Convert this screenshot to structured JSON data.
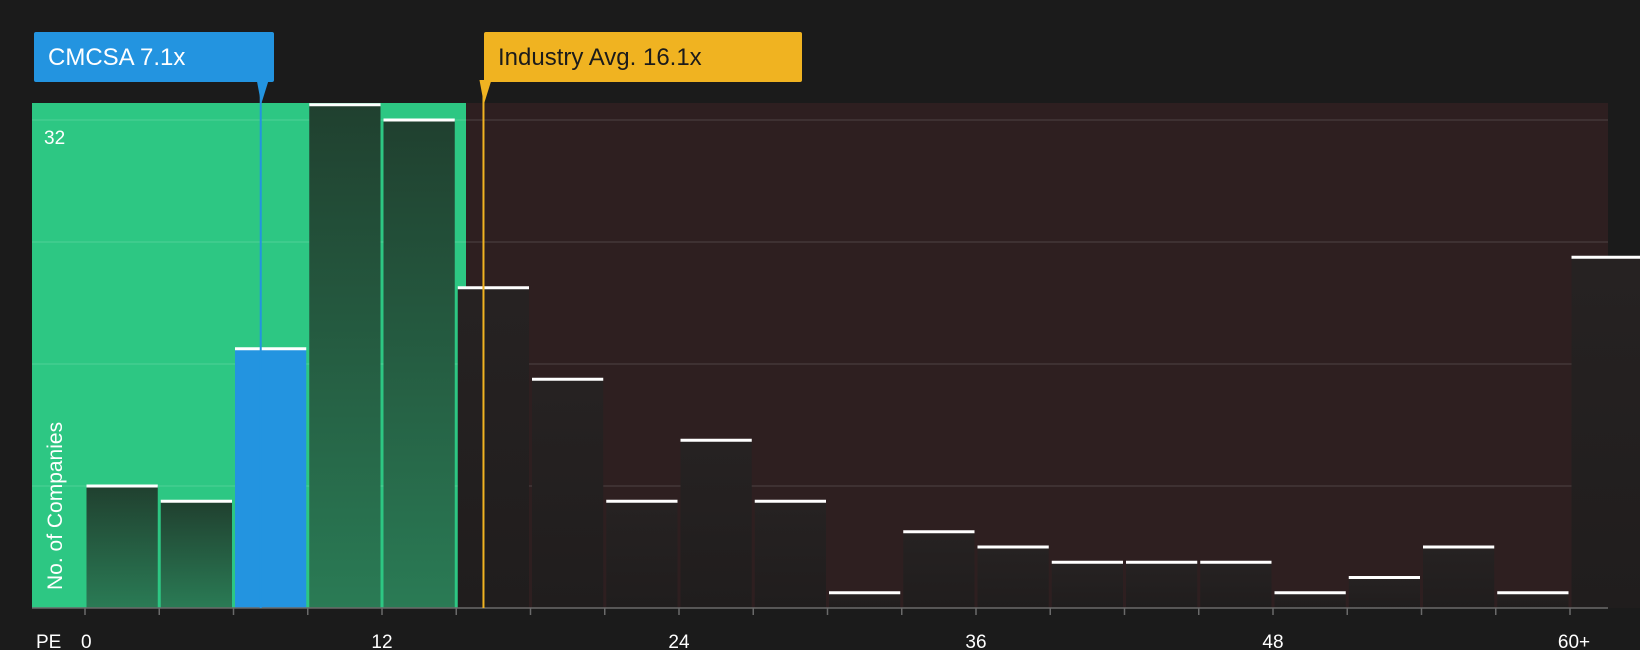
{
  "chart_data": {
    "type": "bar",
    "x_axis_title": "PE",
    "y_axis_title": "No. of Companies",
    "y_tick_label": "32",
    "x_tick_labels": [
      "0",
      "12",
      "24",
      "36",
      "48",
      "60+"
    ],
    "x_tick_values": [
      0,
      12,
      24,
      36,
      48,
      60
    ],
    "xlim": [
      0,
      61.5
    ],
    "ylim": [
      0,
      32
    ],
    "bin_width": 3,
    "bins": [
      {
        "x": 0,
        "count": 8
      },
      {
        "x": 3,
        "count": 7
      },
      {
        "x": 6,
        "count": 17
      },
      {
        "x": 9,
        "count": 33
      },
      {
        "x": 12,
        "count": 32
      },
      {
        "x": 15,
        "count": 21
      },
      {
        "x": 18,
        "count": 15
      },
      {
        "x": 21,
        "count": 7
      },
      {
        "x": 24,
        "count": 11
      },
      {
        "x": 27,
        "count": 7
      },
      {
        "x": 30,
        "count": 1
      },
      {
        "x": 33,
        "count": 5
      },
      {
        "x": 36,
        "count": 4
      },
      {
        "x": 39,
        "count": 3
      },
      {
        "x": 42,
        "count": 3
      },
      {
        "x": 45,
        "count": 3
      },
      {
        "x": 48,
        "count": 1
      },
      {
        "x": 51,
        "count": 2
      },
      {
        "x": 54,
        "count": 4
      },
      {
        "x": 57,
        "count": 1
      },
      {
        "x": 60,
        "count": 23
      }
    ],
    "company": {
      "label": "CMCSA 7.1x",
      "pe": 7.1,
      "color": "#2394e0"
    },
    "industry": {
      "label": "Industry Avg. 16.1x",
      "pe": 16.1,
      "color": "#f0b321"
    },
    "colors": {
      "background": "#1b1b1b",
      "below_avg_region": "#2dc783",
      "above_avg_region": "#2e1f20",
      "bar_dark": "#222020",
      "bar_green_top": "#20402f",
      "bar_green_bottom": "#2a7b55",
      "company_bar": "#2394e0",
      "bar_cap": "#ffffff"
    }
  }
}
